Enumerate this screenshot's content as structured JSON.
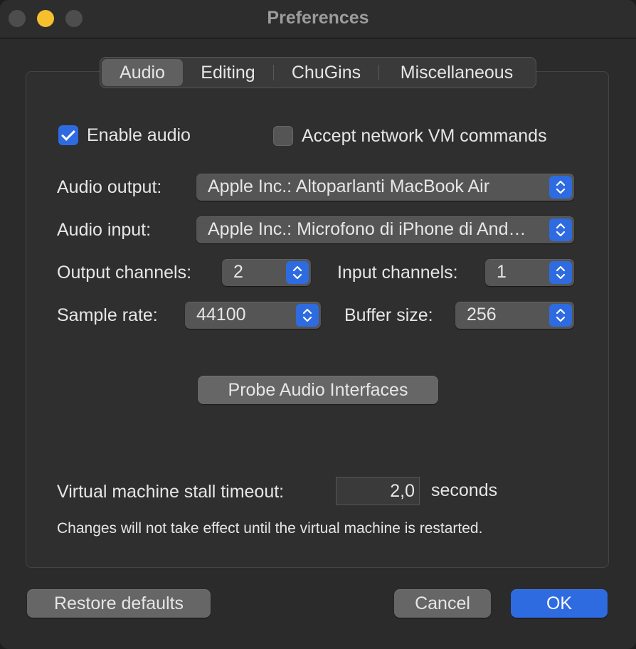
{
  "window": {
    "title": "Preferences"
  },
  "tabs": [
    {
      "label": "Audio",
      "selected": true
    },
    {
      "label": "Editing",
      "selected": false
    },
    {
      "label": "ChuGins",
      "selected": false
    },
    {
      "label": "Miscellaneous",
      "selected": false
    }
  ],
  "audio": {
    "enable_audio": {
      "label": "Enable audio",
      "checked": true
    },
    "accept_network": {
      "label": "Accept network VM commands",
      "checked": false
    },
    "output": {
      "label": "Audio output:",
      "value": "Apple Inc.: Altoparlanti MacBook Air"
    },
    "input": {
      "label": "Audio input:",
      "value": "Apple Inc.: Microfono di iPhone di And…"
    },
    "output_channels": {
      "label": "Output channels:",
      "value": "2"
    },
    "input_channels": {
      "label": "Input channels:",
      "value": "1"
    },
    "sample_rate": {
      "label": "Sample rate:",
      "value": "44100"
    },
    "buffer_size": {
      "label": "Buffer size:",
      "value": "256"
    },
    "probe_button": "Probe Audio Interfaces",
    "stall_timeout": {
      "label": "Virtual machine stall timeout:",
      "value": "2,0",
      "unit": "seconds"
    },
    "note": "Changes will not take effect until the virtual machine is restarted."
  },
  "footer": {
    "restore": "Restore defaults",
    "cancel": "Cancel",
    "ok": "OK"
  },
  "colors": {
    "accent": "#2f6be0",
    "minimize": "#f5bf2e",
    "background": "#2b2b2b"
  }
}
